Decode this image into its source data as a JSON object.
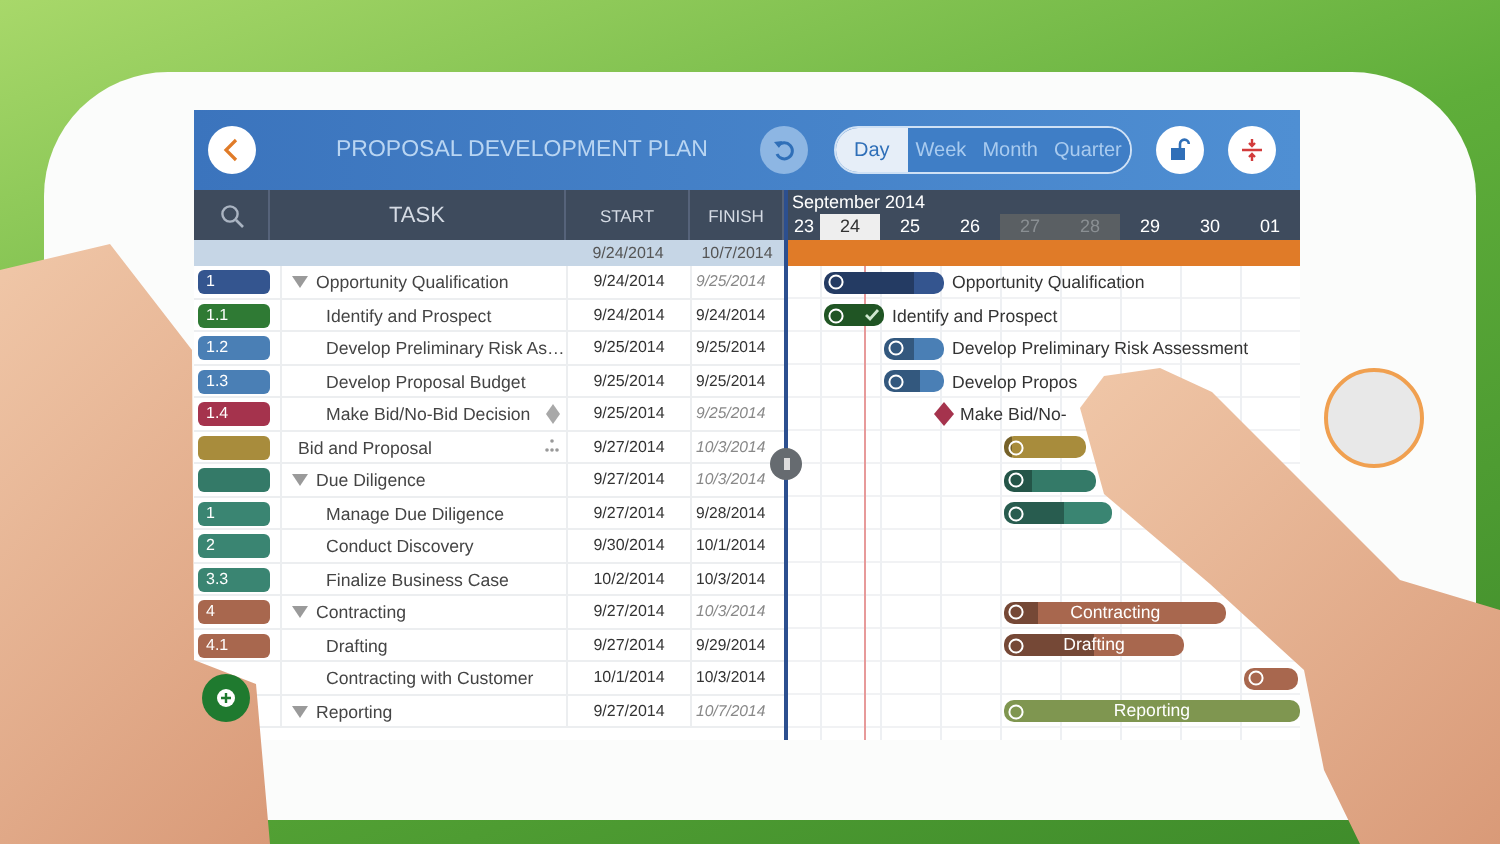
{
  "window": {
    "title": "PROPOSAL DEVELOPMENT PLAN"
  },
  "view_modes": [
    {
      "label": "Day",
      "selected": true
    },
    {
      "label": "Week",
      "selected": false
    },
    {
      "label": "Month",
      "selected": false
    },
    {
      "label": "Quarter",
      "selected": false
    }
  ],
  "columns": {
    "task": "TASK",
    "start": "START",
    "finish": "FINISH"
  },
  "timeline": {
    "month": "September 2014",
    "days": [
      {
        "label": "23",
        "selected": false,
        "weekend": false
      },
      {
        "label": "24",
        "selected": true,
        "weekend": false
      },
      {
        "label": "25",
        "selected": false,
        "weekend": false
      },
      {
        "label": "26",
        "selected": false,
        "weekend": false
      },
      {
        "label": "27",
        "selected": false,
        "weekend": true
      },
      {
        "label": "28",
        "selected": false,
        "weekend": true
      },
      {
        "label": "29",
        "selected": false,
        "weekend": false
      },
      {
        "label": "30",
        "selected": false,
        "weekend": false
      },
      {
        "label": "01",
        "selected": false,
        "weekend": false
      }
    ]
  },
  "project": {
    "start": "9/24/2014",
    "finish": "10/7/2014"
  },
  "tasks": [
    {
      "number": "1",
      "name": "Opportunity Qualification",
      "start": "9/24/2014",
      "finish": "9/25/2014",
      "kind": "summary",
      "color": "#34558f",
      "expanded": true,
      "bar": {
        "level": 0.75,
        "label": "Opportunity Qualification"
      },
      "children": [
        {
          "number": "1.1",
          "name": "Identify and Prospect",
          "start": "9/24/2014",
          "finish": "9/24/2014",
          "kind": "task",
          "color": "#2f7a34",
          "bar": {
            "level": 1,
            "label": "Identify and Prospect"
          }
        },
        {
          "number": "1.2",
          "name": "Develop Preliminary Risk As…",
          "start": "9/25/2014",
          "finish": "9/25/2014",
          "kind": "task",
          "color": "#4a7fb5",
          "bar": {
            "level": 0.5,
            "label": "Develop Preliminary Risk Assessment"
          }
        },
        {
          "number": "1.3",
          "name": "Develop Proposal Budget",
          "start": "9/25/2014",
          "finish": "9/25/2014",
          "kind": "task",
          "color": "#4a7fb5",
          "bar": {
            "level": 0.6,
            "label": "Develop Propos"
          }
        },
        {
          "number": "1.4",
          "name": "Make Bid/No-Bid Decision",
          "start": "9/25/2014",
          "finish": "9/25/2014",
          "kind": "milestone",
          "color": "#a5334d",
          "bar": {
            "label": "Make Bid/No-"
          }
        }
      ]
    },
    {
      "name": "Bid and Proposal",
      "start": "9/27/2014",
      "finish": "10/3/2014",
      "kind": "summary",
      "color": "#a88c3c",
      "bar": {
        "level": 0.1
      }
    },
    {
      "name": "Due Diligence",
      "start": "9/27/2014",
      "finish": "10/3/2014",
      "kind": "summary",
      "color": "#347a68",
      "expanded": true,
      "bar": {
        "level": 0.3
      },
      "children": [
        {
          "number": "1",
          "name": "Manage Due Diligence",
          "start": "9/27/2014",
          "finish": "9/28/2014",
          "kind": "task",
          "color": "#3a8572",
          "bar": {
            "level": 0.55
          }
        },
        {
          "number": "2",
          "name": "Conduct Discovery",
          "start": "9/30/2014",
          "finish": "10/1/2014",
          "kind": "task",
          "color": "#3a8572"
        },
        {
          "number": "3.3",
          "name": "Finalize Business Case",
          "start": "10/2/2014",
          "finish": "10/3/2014",
          "kind": "task",
          "color": "#3a8572"
        }
      ]
    },
    {
      "number": "4",
      "name": "Contracting",
      "start": "9/27/2014",
      "finish": "10/3/2014",
      "kind": "summary",
      "color": "#a8674e",
      "expanded": true,
      "bar": {
        "level": 0.15,
        "label": "Contracting"
      },
      "children": [
        {
          "number": "4.1",
          "name": "Drafting",
          "start": "9/27/2014",
          "finish": "9/29/2014",
          "kind": "task",
          "color": "#a8674e",
          "bar": {
            "level": 0.5,
            "label": "Drafting"
          }
        },
        {
          "name": "Contracting with Customer",
          "start": "10/1/2014",
          "finish": "10/3/2014",
          "kind": "task",
          "color": "#a8674e",
          "bar": {
            "level": 0
          }
        }
      ]
    },
    {
      "name": "Reporting",
      "start": "9/27/2014",
      "finish": "10/7/2014",
      "kind": "summary",
      "color": "#7f9650",
      "expanded": true,
      "bar": {
        "level": 0,
        "label": "Reporting"
      }
    }
  ]
}
